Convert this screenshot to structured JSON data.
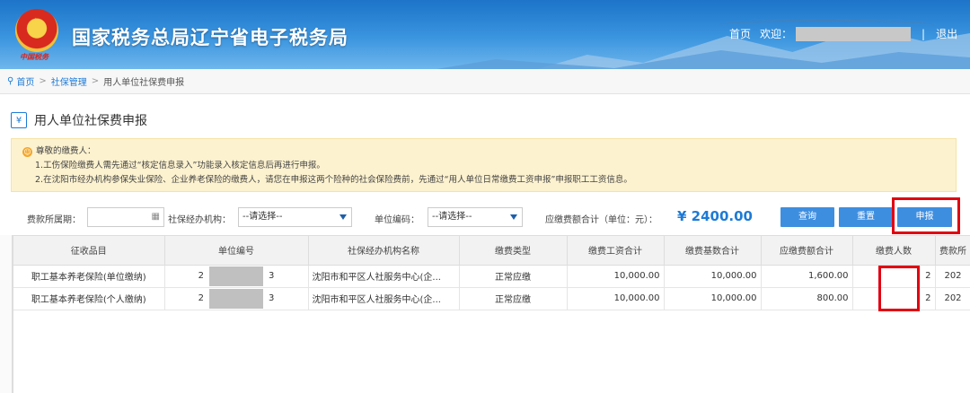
{
  "header": {
    "site_title": "国家税务总局辽宁省电子税务局",
    "seal_text": "中国税务",
    "home_link": "首页",
    "welcome_label": "欢迎：",
    "separator": "|",
    "logout_link": "退出"
  },
  "breadcrumb": {
    "items": [
      "首页",
      "社保管理",
      "用人单位社保费申报"
    ],
    "separator": ">"
  },
  "page": {
    "title": "用人单位社保费申报",
    "title_icon_glyph": "¥"
  },
  "notice": {
    "heading": "尊敬的缴费人：",
    "line1": "1.工伤保险缴费人需先通过“核定信息录入”功能录入核定信息后再进行申报。",
    "line2": "2.在沈阳市经办机构参保失业保险、企业养老保险的缴费人，请您在申报这两个险种的社会保险费前，先通过“用人单位日常缴费工资申报”申报职工工资信息。"
  },
  "filters": {
    "period_label": "费款所属期：",
    "period_value": "",
    "agency_label": "社保经办机构：",
    "agency_value": "--请选择--",
    "unit_code_label": "单位编码：",
    "unit_code_value": "--请选择--",
    "total_label": "应缴费额合计（单位：元）：",
    "total_value": "¥ 2400.00"
  },
  "buttons": {
    "query": "查询",
    "reset": "重置",
    "declare": "申报"
  },
  "table": {
    "columns": [
      "征收品目",
      "单位编号",
      "社保经办机构名称",
      "缴费类型",
      "缴费工资合计",
      "缴费基数合计",
      "应缴费额合计",
      "缴费人数",
      "费款所"
    ],
    "rows": [
      {
        "item": "职工基本养老保险(单位缴纳)",
        "unit_no_prefix": "2",
        "unit_no_suffix": "3",
        "agency": "沈阳市和平区人社服务中心(企...",
        "type": "正常应缴",
        "wage_total": "10,000.00",
        "base_total": "10,000.00",
        "due_total": "1,600.00",
        "count": "2",
        "period": "202"
      },
      {
        "item": "职工基本养老保险(个人缴纳)",
        "unit_no_prefix": "2",
        "unit_no_suffix": "3",
        "agency": "沈阳市和平区人社服务中心(企...",
        "type": "正常应缴",
        "wage_total": "10,000.00",
        "base_total": "10,000.00",
        "due_total": "800.00",
        "count": "2",
        "period": "202"
      }
    ]
  },
  "colors": {
    "brand_blue": "#1d7ad6",
    "button_blue": "#3e8ee0",
    "highlight_red": "#e00012",
    "notice_bg": "#fdf2cf"
  }
}
